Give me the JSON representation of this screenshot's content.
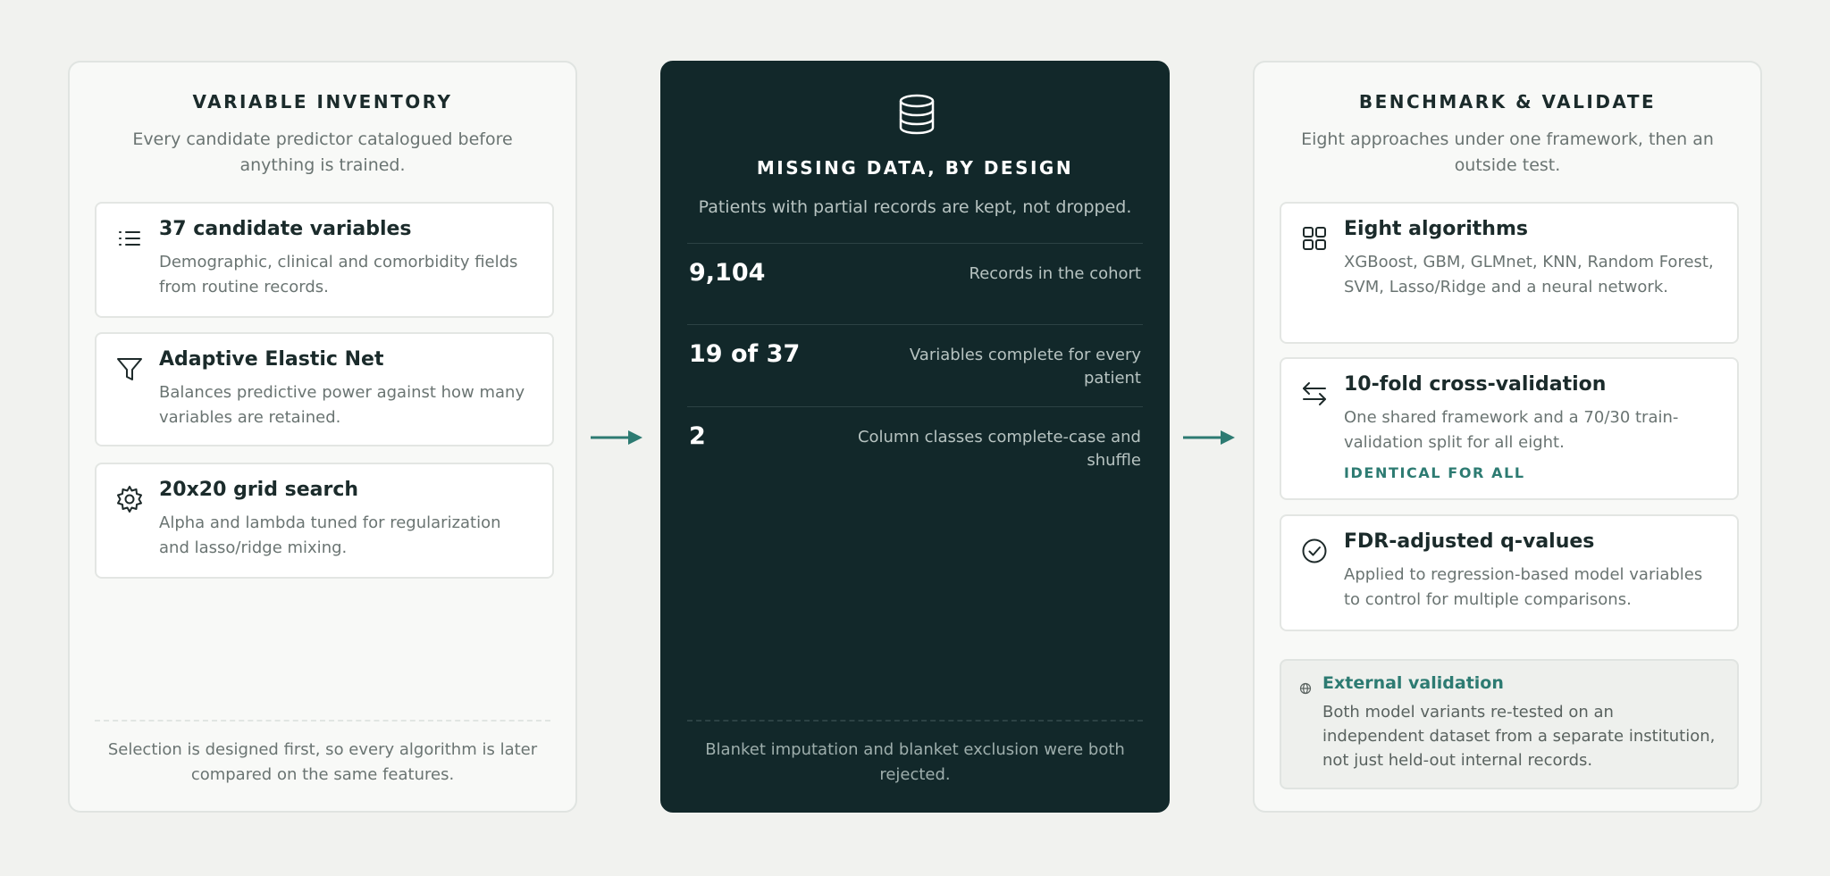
{
  "left_panel": {
    "title": "VARIABLE INVENTORY",
    "subtitle": "Every candidate predictor catalogued before anything is trained.",
    "cards": [
      {
        "icon": "list-icon",
        "title": "37 candidate variables",
        "text": "Demographic, clinical and comorbidity fields from routine records."
      },
      {
        "icon": "filter-icon",
        "title": "Adaptive Elastic Net",
        "text": "Balances predictive power against how many variables are retained."
      },
      {
        "icon": "gear-icon",
        "title": "20x20 grid search",
        "text": "Alpha and lambda tuned for regularization and lasso/ridge mixing."
      }
    ],
    "footer": "Selection is designed first, so every algorithm is later compared on the same features."
  },
  "middle_panel": {
    "icon": "database-icon",
    "title": "MISSING DATA, BY DESIGN",
    "subtitle": "Patients with partial records are kept, not dropped.",
    "stats": [
      {
        "value": "9,104",
        "label": "Records in the cohort"
      },
      {
        "value": "19 of 37",
        "label": "Variables complete for every patient"
      },
      {
        "value": "2",
        "label": "Column classes complete-case and shuffle"
      }
    ],
    "footer": "Blanket imputation and blanket exclusion were both rejected."
  },
  "right_panel": {
    "title": "BENCHMARK & VALIDATE",
    "subtitle": "Eight approaches under one framework, then an outside test.",
    "cards": [
      {
        "icon": "grid-icon",
        "title": "Eight algorithms",
        "text": "XGBoost, GBM, GLMnet, KNN, Random Forest, SVM, Lasso/Ridge and a neural network."
      },
      {
        "icon": "swap-arrows-icon",
        "title": "10-fold cross-validation",
        "text": "One shared framework and a 70/30 train-validation split for all eight.",
        "tag": "IDENTICAL FOR ALL"
      },
      {
        "icon": "check-circle-icon",
        "title": "FDR-adjusted q-values",
        "text": "Applied to regression-based model variables to control for multiple comparisons."
      }
    ],
    "external": {
      "icon": "globe-icon",
      "title": "External validation",
      "text": "Both model variants re-tested on an independent dataset from a separate institution, not just held-out internal records."
    }
  },
  "colors": {
    "background": "#f1f2ef",
    "dark_panel": "#12282a",
    "accent": "#2d7b72"
  }
}
